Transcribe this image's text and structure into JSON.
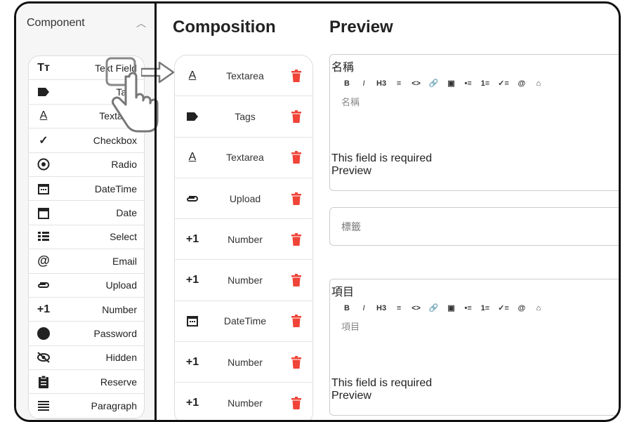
{
  "sidebar": {
    "title": "Component",
    "items": [
      {
        "label": "Text Field",
        "icon": "text-field-icon"
      },
      {
        "label": "Tags",
        "icon": "tag-icon"
      },
      {
        "label": "Textarea",
        "icon": "textarea-icon"
      },
      {
        "label": "Checkbox",
        "icon": "checkmark-icon"
      },
      {
        "label": "Radio",
        "icon": "radio-icon"
      },
      {
        "label": "DateTime",
        "icon": "calendar-clock-icon"
      },
      {
        "label": "Date",
        "icon": "calendar-icon"
      },
      {
        "label": "Select",
        "icon": "list-icon"
      },
      {
        "label": "Email",
        "icon": "at-sign-icon"
      },
      {
        "label": "Upload",
        "icon": "paperclip-icon"
      },
      {
        "label": "Number",
        "icon": "plus-one-icon"
      },
      {
        "label": "Password",
        "icon": "circle-icon"
      },
      {
        "label": "Hidden",
        "icon": "eye-off-icon"
      },
      {
        "label": "Reserve",
        "icon": "clipboard-icon"
      },
      {
        "label": "Paragraph",
        "icon": "paragraph-icon"
      }
    ]
  },
  "composition": {
    "title": "Composition",
    "items": [
      {
        "label": "Textarea",
        "icon": "textarea-icon"
      },
      {
        "label": "Tags",
        "icon": "tag-icon"
      },
      {
        "label": "Textarea",
        "icon": "textarea-icon"
      },
      {
        "label": "Upload",
        "icon": "paperclip-icon"
      },
      {
        "label": "Number",
        "icon": "plus-one-icon"
      },
      {
        "label": "Number",
        "icon": "plus-one-icon"
      },
      {
        "label": "DateTime",
        "icon": "calendar-clock-icon"
      },
      {
        "label": "Number",
        "icon": "plus-one-icon"
      },
      {
        "label": "Number",
        "icon": "plus-one-icon"
      }
    ]
  },
  "preview": {
    "title": "Preview",
    "block1": {
      "label": "名稱",
      "placeholder": "名稱",
      "error": "This field is required",
      "footer": "Preview"
    },
    "tags_placeholder": "標籤",
    "block2": {
      "label": "項目",
      "placeholder": "項目",
      "error": "This field is required",
      "footer": "Preview"
    },
    "toolbar": [
      "B",
      "I",
      "H3",
      "≡",
      "<>",
      "🔗",
      "▣",
      "•≡",
      "1≡",
      "✓≡",
      "@",
      "⌂"
    ]
  },
  "colors": {
    "accent_red": "#f04438",
    "frame": "#111111"
  }
}
